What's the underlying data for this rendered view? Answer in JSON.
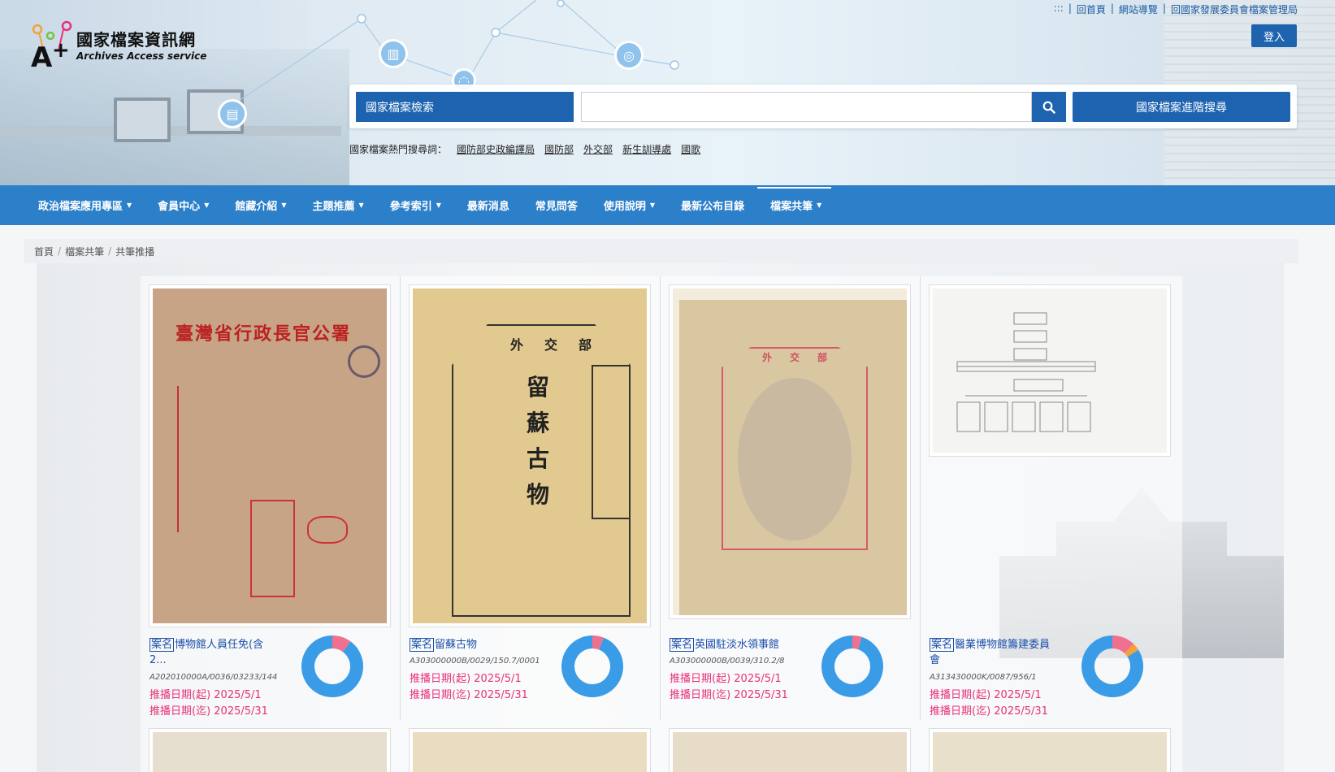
{
  "site": {
    "name_zh": "國家檔案資訊網",
    "name_en": "Archives Access service",
    "toplinks": [
      ":::",
      "|",
      "回首頁",
      "|",
      "網站導覽",
      "|",
      "回國家發展委員會檔案管理局"
    ],
    "login_label": "登入"
  },
  "search": {
    "select_label": "國家檔案檢索",
    "input_placeholder": "",
    "advanced_label": "國家檔案進階搜尋",
    "hot_label": "國家檔案熱門搜尋詞：",
    "hot_terms": [
      "國防部史政編譯局",
      "國防部",
      "外交部",
      "新生訓導處",
      "國歌"
    ]
  },
  "nav": [
    {
      "label": "政治檔案應用專區",
      "caret": true
    },
    {
      "label": "會員中心",
      "caret": true
    },
    {
      "label": "館藏介紹",
      "caret": true
    },
    {
      "label": "主題推薦",
      "caret": true
    },
    {
      "label": "參考索引",
      "caret": true
    },
    {
      "label": "最新消息",
      "caret": false
    },
    {
      "label": "常見問答",
      "caret": false
    },
    {
      "label": "使用說明",
      "caret": true
    },
    {
      "label": "最新公布目錄",
      "caret": false
    },
    {
      "label": "檔案共筆",
      "caret": true,
      "active": true
    }
  ],
  "breadcrumb": [
    "首頁",
    "檔案共筆",
    "共筆推播"
  ],
  "cards": [
    {
      "tag": "案名",
      "title_line1": "博物館人員任免(含",
      "title_line2": "2...",
      "code": "A202010000A/0036/03233/144",
      "start": "推播日期(起) 2025/5/1",
      "end": "推播日期(迄) 2025/5/31",
      "donut": {
        "main": 0.9,
        "main_color": "#3a9ce6",
        "accent": 0.1,
        "accent_color": "#f07090"
      },
      "doc_title": "臺灣省行政長官公署"
    },
    {
      "tag": "案名",
      "title_line1": "留蘇古物",
      "title_line2": "",
      "code": "A303000000B/0029/150.7/0001",
      "start": "推播日期(起) 2025/5/1",
      "end": "推播日期(迄) 2025/5/31",
      "donut": {
        "main": 0.94,
        "main_color": "#3a9ce6",
        "accent": 0.06,
        "accent_color": "#f07090"
      },
      "doc_title": "外交部"
    },
    {
      "tag": "案名",
      "title_line1": "英國駐淡水領事館",
      "title_line2": "",
      "code": "A303000000B/0039/310.2/8",
      "start": "推播日期(起) 2025/5/1",
      "end": "推播日期(迄) 2025/5/31",
      "donut": {
        "main": 0.95,
        "main_color": "#3a9ce6",
        "accent": 0.05,
        "accent_color": "#f07090"
      },
      "doc_title": "外交部"
    },
    {
      "tag": "案名",
      "title_line1": "醫業博物館籌建委員",
      "title_line2": "會",
      "code": "A313430000K/0087/956/1",
      "start": "推播日期(起) 2025/5/1",
      "end": "推播日期(迄) 2025/5/31",
      "donut": {
        "main": 0.84,
        "main_color": "#3a9ce6",
        "accent": 0.12,
        "accent_color": "#f07090",
        "accent2": 0.04,
        "accent2_color": "#f2a23a"
      },
      "doc_title": ""
    }
  ]
}
